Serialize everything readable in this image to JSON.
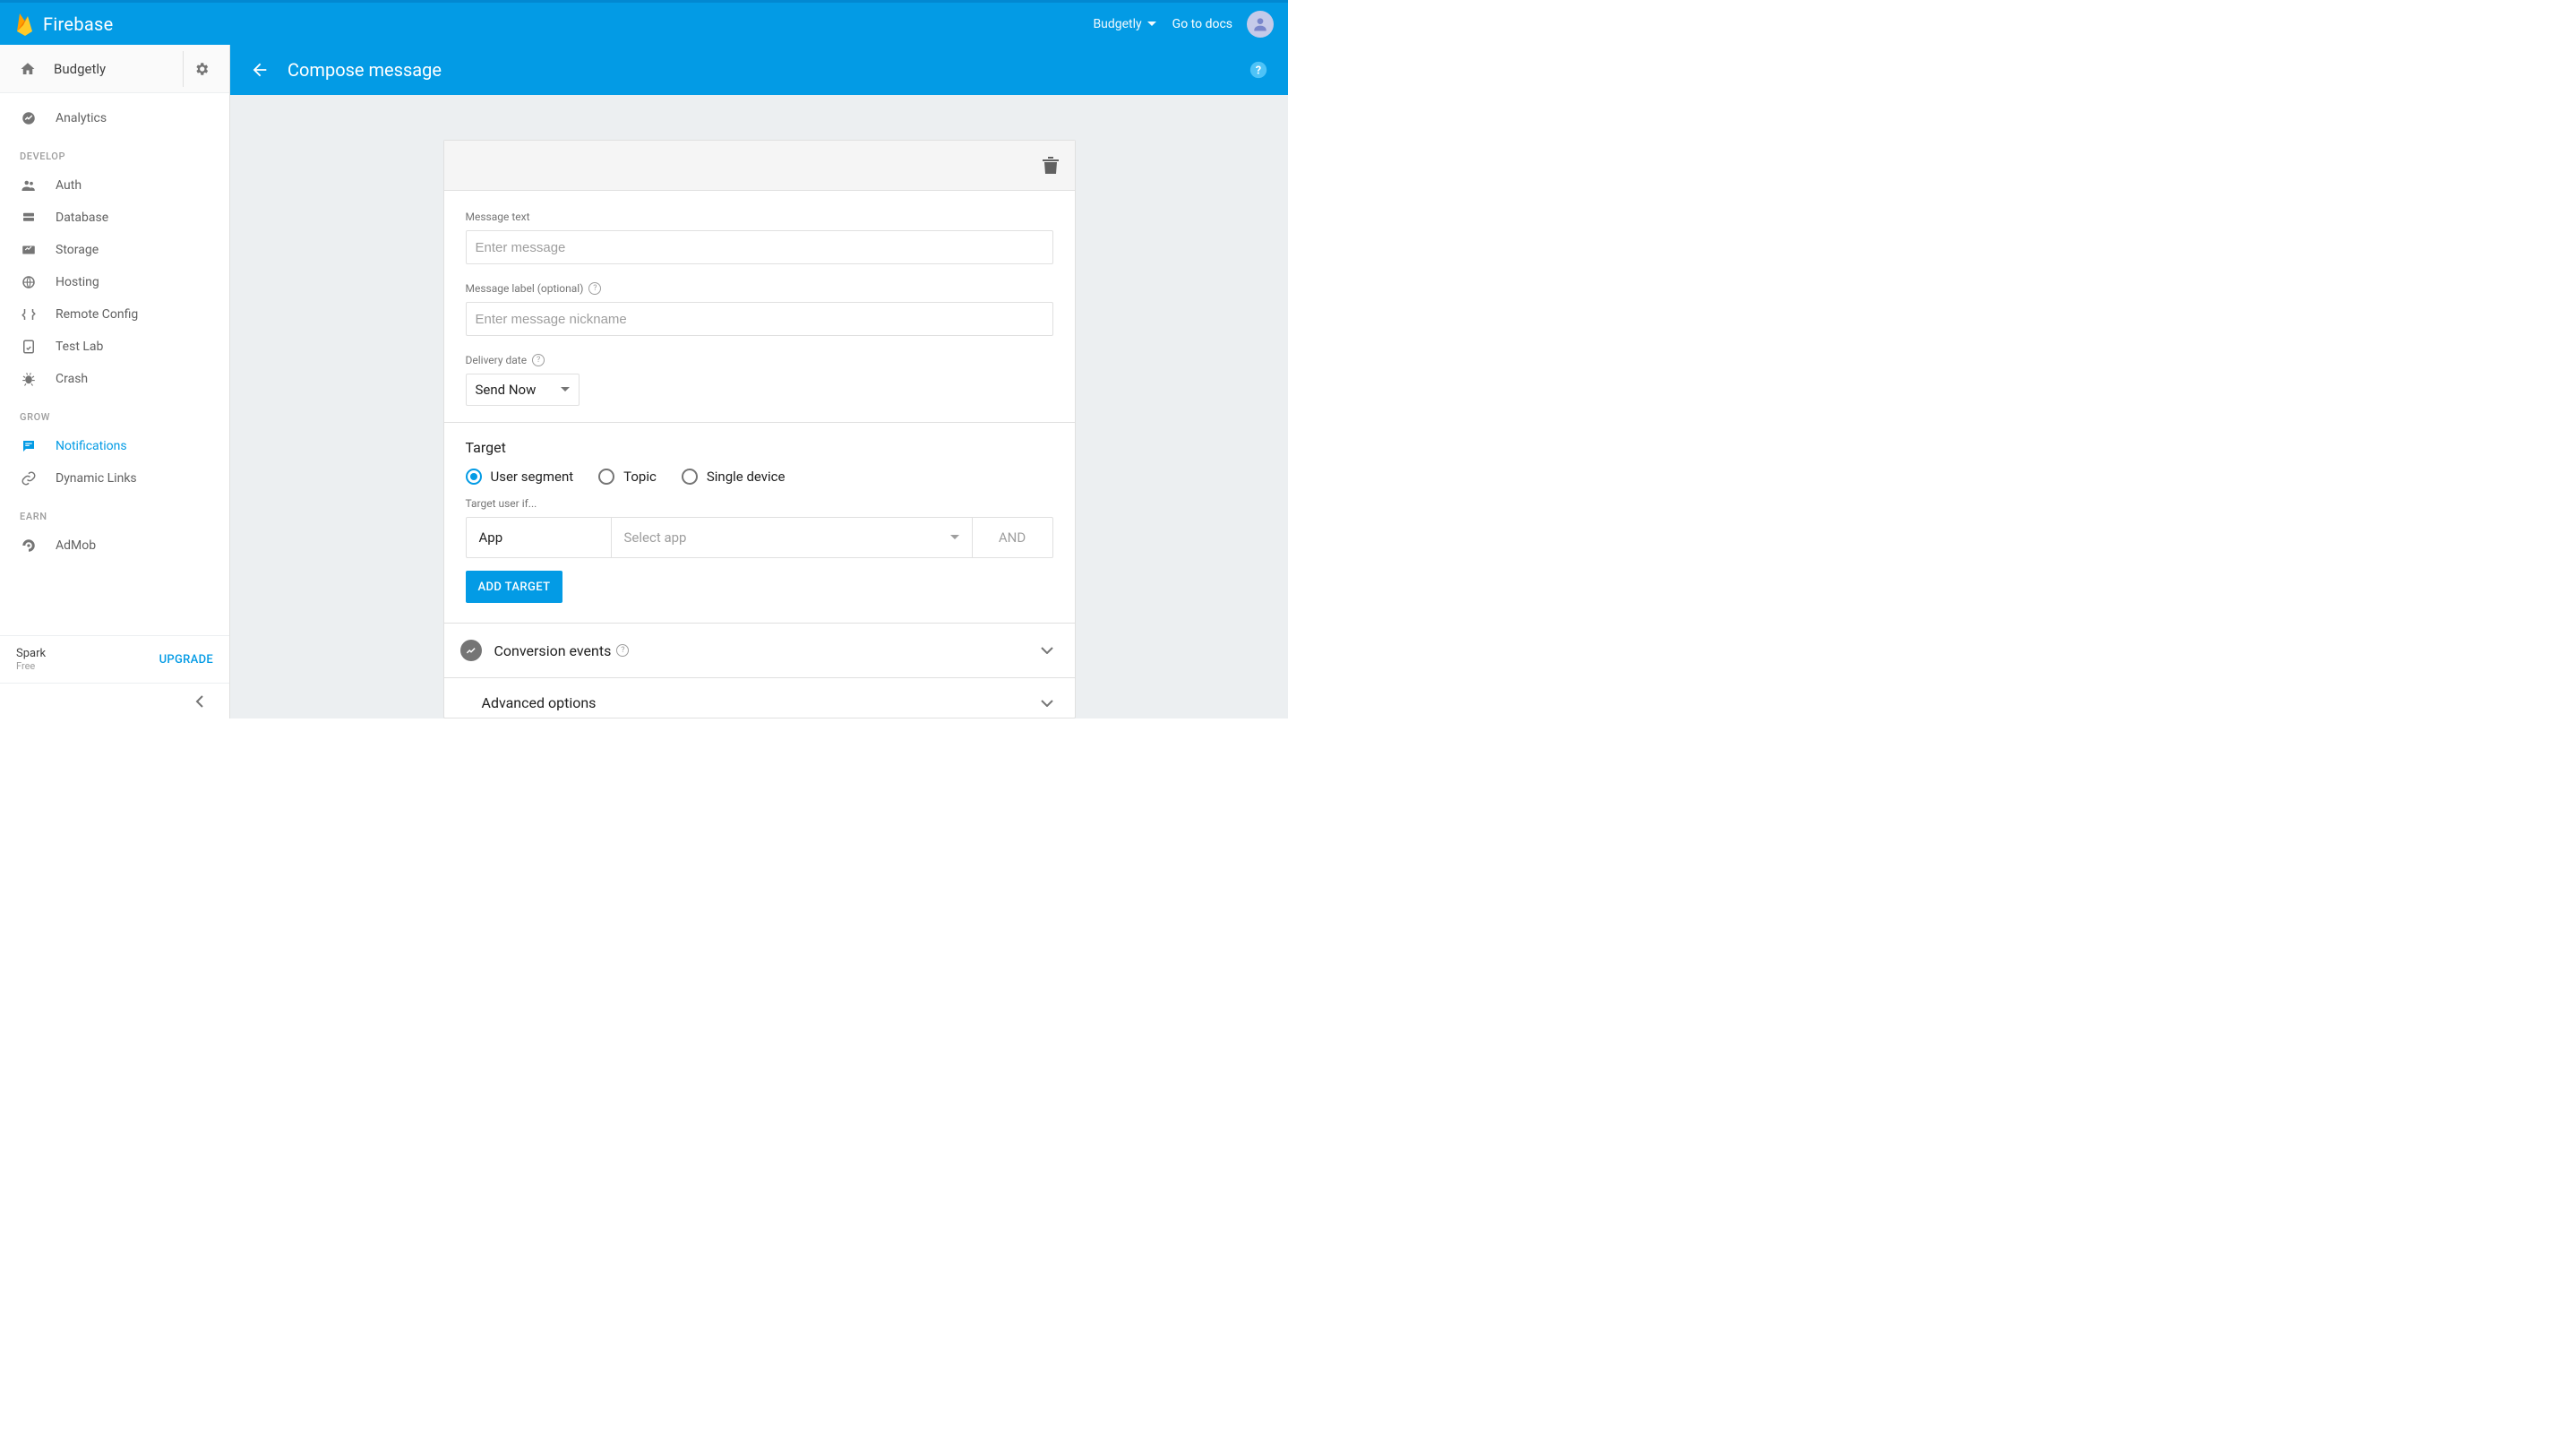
{
  "brand": "Firebase",
  "header": {
    "project_switcher": "Budgetly",
    "docs_link": "Go to docs"
  },
  "subbar": {
    "title": "Compose message"
  },
  "sidebar": {
    "project_name": "Budgetly",
    "analytics_label": "Analytics",
    "sections": {
      "develop": "DEVELOP",
      "grow": "GROW",
      "earn": "EARN"
    },
    "develop_items": [
      {
        "label": "Auth"
      },
      {
        "label": "Database"
      },
      {
        "label": "Storage"
      },
      {
        "label": "Hosting"
      },
      {
        "label": "Remote Config"
      },
      {
        "label": "Test Lab"
      },
      {
        "label": "Crash"
      }
    ],
    "grow_items": [
      {
        "label": "Notifications",
        "active": true
      },
      {
        "label": "Dynamic Links"
      }
    ],
    "earn_items": [
      {
        "label": "AdMob"
      }
    ],
    "plan": {
      "name": "Spark",
      "sub": "Free",
      "upgrade": "UPGRADE"
    }
  },
  "compose": {
    "labels": {
      "message_text": "Message text",
      "message_label": "Message label (optional)",
      "delivery_date": "Delivery date"
    },
    "placeholders": {
      "message_text": "Enter message",
      "message_label": "Enter message nickname"
    },
    "delivery_selected": "Send Now",
    "target": {
      "title": "Target",
      "options": [
        "User segment",
        "Topic",
        "Single device"
      ],
      "selected_index": 0,
      "sub_label": "Target user if...",
      "app_label": "App",
      "select_placeholder": "Select app",
      "and_label": "AND",
      "add_button": "ADD TARGET"
    },
    "accordions": {
      "conversion": "Conversion events",
      "advanced": "Advanced options"
    }
  }
}
